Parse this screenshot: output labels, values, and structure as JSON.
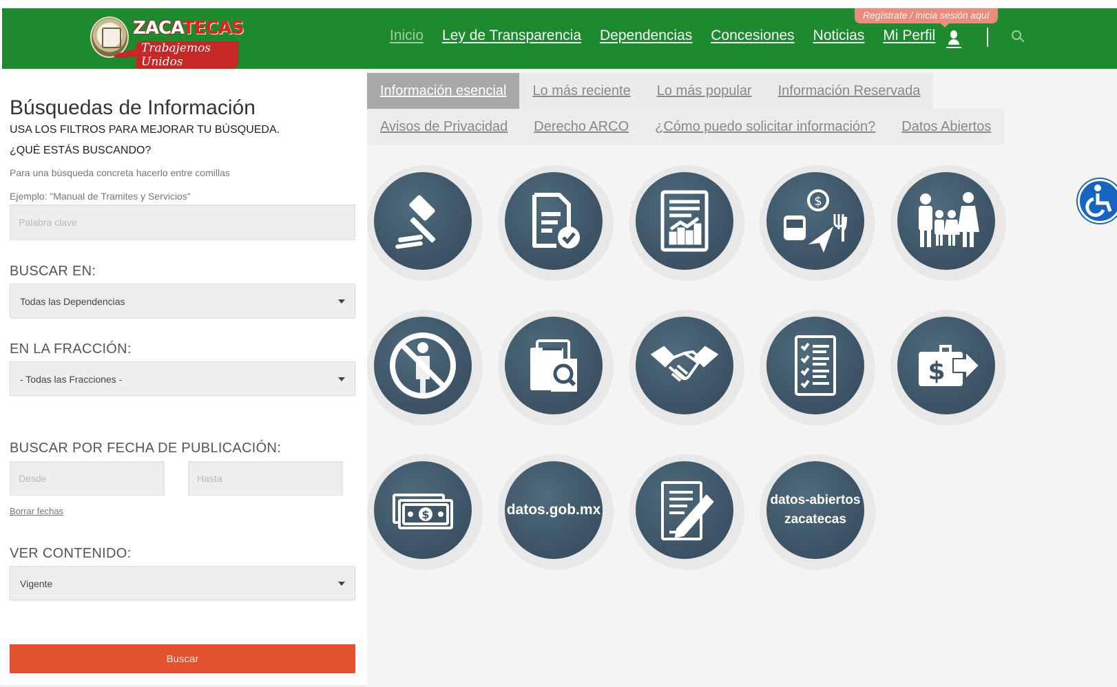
{
  "header": {
    "logo": {
      "word_left": "ZACA",
      "word_right": "TECAS",
      "slogan": "Trabajemos Unidos"
    },
    "nav": [
      {
        "label": "Inicio"
      },
      {
        "label": "Ley de Transparencia"
      },
      {
        "label": "Dependencias"
      },
      {
        "label": "Concesiones"
      },
      {
        "label": "Noticias"
      },
      {
        "label": "Mi Perfil"
      }
    ],
    "login_tooltip": "Regístrate / inicia sesión aquí",
    "icons": [
      "user-icon",
      "search-icon"
    ]
  },
  "sidebar": {
    "title": "Búsquedas de Información",
    "subtitle": "USA LOS FILTROS PARA MEJORAR TU BÚSQUEDA.",
    "question": "¿QUÉ ESTÁS BUSCANDO?",
    "hint1": "Para una búsqueda concreta hacerlo entre comillas",
    "hint2": "Ejemplo: \"Manual de Tramites y Servicios\"",
    "keyword_placeholder": "Palabra clave",
    "search_in_label": "BUSCAR EN:",
    "search_in_value": "Todas las Dependencias",
    "fraction_label": "EN LA FRACCIÓN:",
    "fraction_value": "- Todas las Fracciones -",
    "date_label": "BUSCAR POR FECHA DE PUBLICACIÓN:",
    "date_from_placeholder": "Desde",
    "date_to_placeholder": "Hasta",
    "clear_dates": "Borrar fechas",
    "content_label": "VER CONTENIDO:",
    "content_value": "Vigente",
    "search_button": "Buscar"
  },
  "main": {
    "tabs_row1": [
      {
        "label": "Información esencial",
        "active": true
      },
      {
        "label": "Lo más reciente"
      },
      {
        "label": "Lo más popular"
      },
      {
        "label": "Información Reservada"
      }
    ],
    "tabs_row2": [
      {
        "label": "Avisos de Privacidad"
      },
      {
        "label": "Derecho ARCO"
      },
      {
        "label": "¿Cómo puedo solicitar información?"
      },
      {
        "label": "Datos Abiertos"
      }
    ],
    "tiles": [
      {
        "icon": "gavel-icon"
      },
      {
        "icon": "document-check-icon"
      },
      {
        "icon": "report-chart-icon"
      },
      {
        "icon": "travel-expenses-icon"
      },
      {
        "icon": "family-icon"
      },
      {
        "icon": "no-corruption-icon"
      },
      {
        "icon": "file-search-icon"
      },
      {
        "icon": "handshake-icon"
      },
      {
        "icon": "checklist-icon"
      },
      {
        "icon": "money-transfer-icon"
      },
      {
        "icon": "cash-icon"
      },
      {
        "icon": "datos-gob-icon",
        "text": "datos.gob.mx"
      },
      {
        "icon": "contract-sign-icon"
      },
      {
        "icon": "datos-abiertos-zacatecas-icon",
        "text_line1": "datos-abiertos",
        "text_line2": "zacatecas"
      }
    ]
  },
  "accessibility": {
    "icon": "wheelchair-icon"
  },
  "colors": {
    "header_green": "#1e8a2e",
    "tile_blue": "#3d5567",
    "button_orange": "#e4522d",
    "tooltip_salmon": "#e88c7e",
    "access_blue": "#1565c0"
  }
}
